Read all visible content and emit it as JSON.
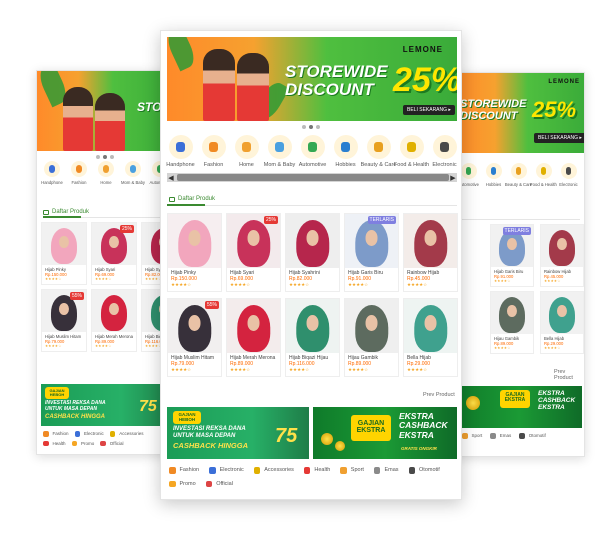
{
  "banner": {
    "brand": "LEMONE",
    "headline_line1": "STOREWIDE",
    "headline_line2": "DISCOUNT",
    "discount": "25%",
    "cta": "BELI SEKARANG ▸",
    "left_headline": "STORE",
    "right_headline_line1": "STOREWIDE",
    "right_headline_line2": "DISCOUNT"
  },
  "categories": [
    {
      "label": "Handphone",
      "icon": "phone-icon",
      "color": "#3b6fd8"
    },
    {
      "label": "Fashion",
      "icon": "dress-icon",
      "color": "#f08a24"
    },
    {
      "label": "Home",
      "icon": "home-icon",
      "color": "#f0a030"
    },
    {
      "label": "Mom & Baby",
      "icon": "baby-icon",
      "color": "#4aa0e0"
    },
    {
      "label": "Automotive",
      "icon": "car-icon",
      "color": "#34a853"
    },
    {
      "label": "Hobbies",
      "icon": "hobby-icon",
      "color": "#2a7fd0"
    },
    {
      "label": "Beauty & Care",
      "icon": "beauty-icon",
      "color": "#e8a020"
    },
    {
      "label": "Food & Health",
      "icon": "food-icon",
      "color": "#e0b000"
    },
    {
      "label": "Electronic",
      "icon": "electronic-icon",
      "color": "#4a4a4a"
    }
  ],
  "left_categories": [
    "Handphone",
    "Fashion",
    "Home",
    "Mom & Baby",
    "Automotive"
  ],
  "right_categories": [
    "Automotive",
    "Hobbies",
    "Beauty & Care",
    "Food & Health",
    "Electronic"
  ],
  "section_title": "Daftar Produk",
  "products": [
    {
      "name": "Hijab Pinky",
      "price": "Rp.150.000",
      "stars": "★★★★☆",
      "badge": "",
      "hijab": "#f2a6bd",
      "bg": "#f6eef0"
    },
    {
      "name": "Hijab Syari",
      "price": "Rp.69.000",
      "stars": "★★★★☆",
      "badge": "25%",
      "hijab": "#c8325a",
      "bg": "#f3eaec"
    },
    {
      "name": "Hijab Syahrini",
      "price": "Rp.82.000",
      "stars": "★★★★☆",
      "badge": "",
      "hijab": "#b6264c",
      "bg": "#eee"
    },
    {
      "name": "Hijab Garis Biru",
      "price": "Rp.91.000",
      "stars": "★★★★☆",
      "badge": "TERLARIS",
      "hijab": "#7d9bc9",
      "bg": "#eef1f6"
    },
    {
      "name": "Rainbow Hijab",
      "price": "Rp.45.000",
      "stars": "★★★★☆",
      "badge": "",
      "hijab": "#a33a4a",
      "bg": "#f3ece9"
    },
    {
      "name": "Hijab Muslim Hitam",
      "price": "Rp.79.000",
      "stars": "★★★★☆",
      "badge": "55%",
      "hijab": "#37303a",
      "bg": "#f1efef"
    },
    {
      "name": "Hijab Merah Merona",
      "price": "Rp.89.000",
      "stars": "★★★★☆",
      "badge": "",
      "hijab": "#d4233f",
      "bg": "#f3ecec"
    },
    {
      "name": "Hijab Biqazi Hijau",
      "price": "Rp.116.000",
      "stars": "★★★★☆",
      "badge": "",
      "hijab": "#2f8f6d",
      "bg": "#eef3f1"
    },
    {
      "name": "Hijau Gambik",
      "price": "Rp.89.000",
      "stars": "★★★★☆",
      "badge": "",
      "hijab": "#5d6b5f",
      "bg": "#efefef"
    },
    {
      "name": "Bella Hijab",
      "price": "Rp.29.000",
      "stars": "★★★★☆",
      "badge": "",
      "hijab": "#3fa18e",
      "bg": "#eef4f2"
    }
  ],
  "left_products": [
    {
      "name": "Hijab Pinky",
      "price": "Rp.150.000",
      "stars": "★★★★☆",
      "badge": "",
      "hijab": "#f2a6bd"
    },
    {
      "name": "Hijab Syari",
      "price": "Rp.69.000",
      "stars": "★★★★☆",
      "badge": "25%",
      "hijab": "#c8325a"
    },
    {
      "name": "Hijab Syah",
      "price": "Rp.82.000",
      "stars": "★★★★☆",
      "badge": "",
      "hijab": "#b6264c"
    },
    {
      "name": "Hijab Muslim Hitam",
      "price": "Rp.79.000",
      "stars": "★★★★☆",
      "badge": "55%",
      "hijab": "#37303a"
    },
    {
      "name": "Hijab Merah Merona",
      "price": "Rp.89.000",
      "stars": "★★★★☆",
      "badge": "",
      "hijab": "#d4233f"
    },
    {
      "name": "Hijab Biqa",
      "price": "Rp.116.000",
      "stars": "★★★★☆",
      "badge": "",
      "hijab": "#2f8f6d"
    }
  ],
  "right_products": [
    {
      "name": "Hijab Garis Biru",
      "price": "Rp.91.000",
      "stars": "★★★★☆",
      "badge": "TERLARIS",
      "hijab": "#7d9bc9"
    },
    {
      "name": "Rainbow Hijab",
      "price": "Rp.45.000",
      "stars": "★★★★☆",
      "badge": "",
      "hijab": "#a33a4a"
    },
    {
      "name": "Hijau Gambik",
      "price": "Rp.89.000",
      "stars": "★★★★☆",
      "badge": "",
      "hijab": "#5d6b5f"
    },
    {
      "name": "Bella Hijab",
      "price": "Rp.29.000",
      "stars": "★★★★☆",
      "badge": "",
      "hijab": "#3fa18e"
    }
  ],
  "see_more": "Prev Product",
  "promo_invest": {
    "logo_line1": "GAJIAN",
    "logo_line2": "HEBOH",
    "line1": "INVESTASI REKSA DANA",
    "line2": "UNTUK MASA DEPAN",
    "line3": "CASHBACK HINGGA",
    "amount": "75",
    "unit": "rb"
  },
  "promo_gajian": {
    "logo_line1": "GAJIAN",
    "logo_line2": "EKSTRA",
    "line1": "EKSTRA",
    "line2": "CASHBACK",
    "line3": "EKSTRA",
    "line4": "GRATIS ONGKIR"
  },
  "tags": [
    {
      "label": "Fashion",
      "color": "#f08a24"
    },
    {
      "label": "Electronic",
      "color": "#3b6fd8"
    },
    {
      "label": "Accessories",
      "color": "#e0b000"
    },
    {
      "label": "Health",
      "color": "#e53935"
    },
    {
      "label": "Sport",
      "color": "#f0a030"
    },
    {
      "label": "Emas",
      "color": "#8a8a8a"
    },
    {
      "label": "Otomotif",
      "color": "#4a4a4a"
    },
    {
      "label": "Promo",
      "color": "#f5a623"
    },
    {
      "label": "Official",
      "color": "#d44"
    }
  ],
  "left_tags": [
    "Fashion",
    "Electronic",
    "Accessories",
    "Health",
    "Promo",
    "Official"
  ],
  "right_tags": [
    "Sport",
    "Emas",
    "Otomotif"
  ]
}
